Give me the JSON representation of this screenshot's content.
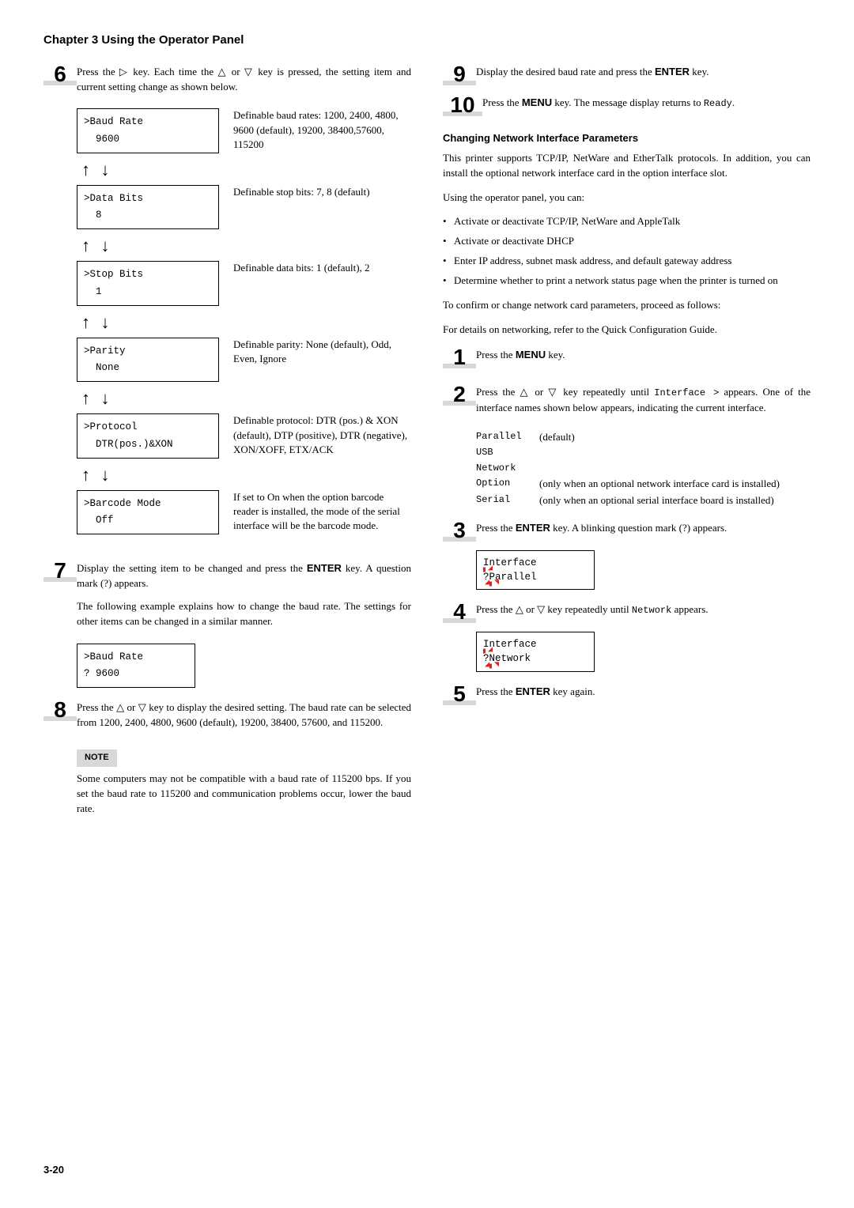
{
  "chapter": "Chapter 3  Using the Operator Panel",
  "page_num": "3-20",
  "left": {
    "step6": {
      "num": "6",
      "text": "Press the ▷ key. Each time the △ or ▽ key is pressed, the setting item and current setting change as shown below."
    },
    "params": [
      {
        "box_l1": ">Baud Rate",
        "box_l2": "  9600",
        "desc": "Definable baud rates: 1200, 2400, 4800, 9600 (default), 19200, 38400,57600, 115200"
      },
      {
        "box_l1": ">Data Bits",
        "box_l2": "  8",
        "desc": "Definable stop bits: 7, 8 (default)"
      },
      {
        "box_l1": ">Stop Bits",
        "box_l2": "  1",
        "desc": "Definable data bits: 1 (default), 2"
      },
      {
        "box_l1": ">Parity",
        "box_l2": "  None",
        "desc": "Definable parity: None (default), Odd, Even, Ignore"
      },
      {
        "box_l1": ">Protocol",
        "box_l2": "  DTR(pos.)&XON",
        "desc": "Definable protocol: DTR (pos.) & XON (default), DTP (positive), DTR (negative), XON/XOFF, ETX/ACK"
      },
      {
        "box_l1": ">Barcode Mode",
        "box_l2": "  Off",
        "desc": "If set to On when the option barcode reader is installed, the mode of the serial interface will be the barcode mode."
      }
    ],
    "step7": {
      "num": "7",
      "p1": "Display the setting item to be changed and press the ",
      "enter": "ENTER",
      "p2": " key. A question mark (?) appears.",
      "p3": "The following example explains how to change the baud rate. The settings for other items can be changed in a similar manner.",
      "box_l1": ">Baud Rate",
      "box_l2": "? 9600"
    },
    "step8": {
      "num": "8",
      "text": "Press the △ or ▽ key to display the desired setting. The baud rate can be selected from 1200, 2400, 4800, 9600 (default), 19200, 38400, 57600, and 115200."
    },
    "note": {
      "label": "NOTE",
      "text": "Some computers may not be compatible with a baud rate of 115200 bps. If you set the baud rate to 115200 and communication problems occur, lower the baud rate."
    }
  },
  "right": {
    "step9": {
      "num": "9",
      "p1": "Display the desired baud rate and press the ",
      "enter": "ENTER",
      "p2": " key."
    },
    "step10": {
      "num": "10",
      "p1": "Press the ",
      "menu": "MENU",
      "p2": " key. The message display returns to ",
      "ready": "Ready",
      "p3": "."
    },
    "heading": "Changing Network Interface Parameters",
    "intro": "This printer supports TCP/IP, NetWare and EtherTalk protocols. In addition, you can install the optional network interface card in the option interface slot.",
    "using": "Using the operator panel, you can:",
    "bullets": [
      "Activate or deactivate TCP/IP, NetWare and AppleTalk",
      "Activate or deactivate DHCP",
      "Enter IP address, subnet mask address, and default gateway address",
      "Determine whether to print a network status page when the printer is turned on"
    ],
    "confirm": "To confirm or change network card parameters, proceed as follows:",
    "details": "For details on networking, refer to the Quick Configuration Guide.",
    "step1": {
      "num": "1",
      "p1": "Press the ",
      "menu": "MENU",
      "p2": " key."
    },
    "step2": {
      "num": "2",
      "p1": "Press the △ or ▽ key repeatedly until ",
      "iface": "Interface >",
      "p2": " appears. One of the interface names shown below appears, indicating the current interface."
    },
    "iface_list": [
      {
        "name": "Parallel",
        "note": "(default)"
      },
      {
        "name": "USB",
        "note": ""
      },
      {
        "name": "Network",
        "note": ""
      },
      {
        "name": "Option",
        "note": "(only when an optional network interface card is installed)"
      },
      {
        "name": "Serial",
        "note": "(only when an optional serial interface board is installed)"
      }
    ],
    "step3": {
      "num": "3",
      "p1": "Press the ",
      "enter": "ENTER",
      "p2": " key. A blinking question mark (?) appears.",
      "box_l1": "Interface",
      "box_l2": "?Parallel"
    },
    "step4": {
      "num": "4",
      "p1": "Press the △ or ▽ key repeatedly until ",
      "net": "Network",
      "p2": " appears.",
      "box_l1": "Interface",
      "box_l2": "?Network"
    },
    "step5": {
      "num": "5",
      "p1": "Press the ",
      "enter": "ENTER",
      "p2": " key again."
    }
  }
}
